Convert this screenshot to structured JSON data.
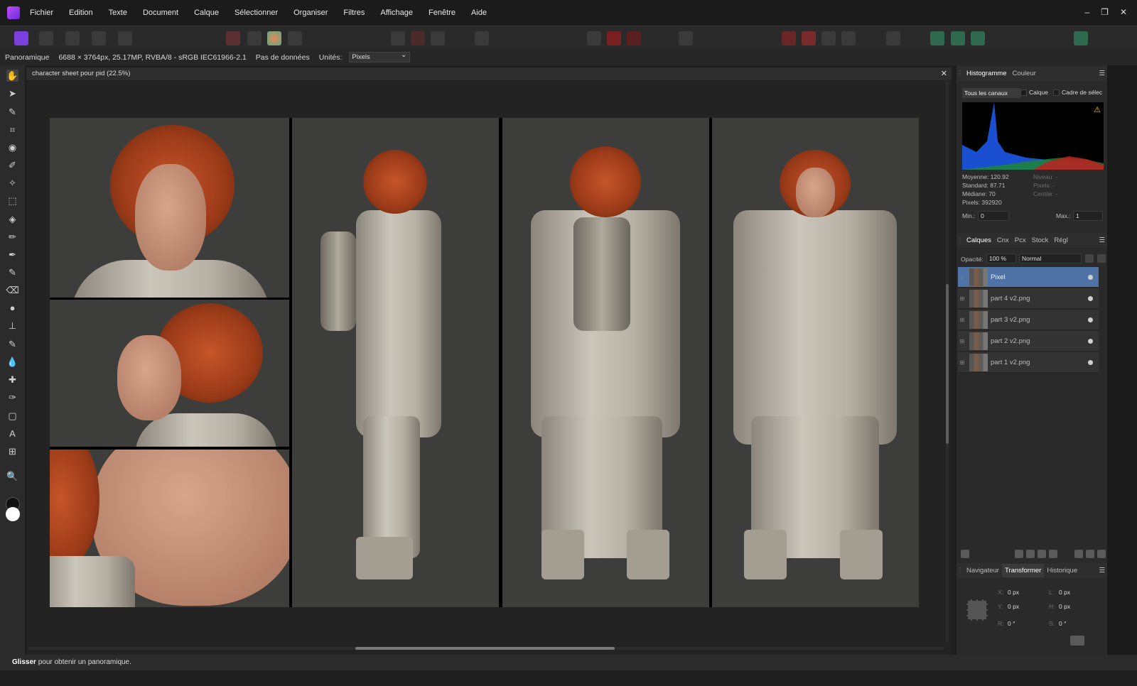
{
  "app": {
    "logo": "affinity-photo-logo",
    "menu": [
      "Fichier",
      "Edition",
      "Texte",
      "Document",
      "Calque",
      "Sélectionner",
      "Organiser",
      "Filtres",
      "Affichage",
      "Fenêtre",
      "Aide"
    ],
    "window_controls": {
      "minimize": "–",
      "restore": "❐",
      "close": "✕"
    }
  },
  "context": {
    "tool_name": "Panoramique",
    "image_info": "6688 × 3764px, 25.17MP, RVBA/8 - sRGB IEC61966-2.1",
    "data_label": "Pas de données",
    "units_label": "Unités:",
    "units_value": "Pixels"
  },
  "document": {
    "tab_title": "character sheet pour pid (22.5%)",
    "close_label": "✕"
  },
  "status": {
    "bold": "Glisser",
    "text": " pour obtenir un panoramique."
  },
  "histogram_panel": {
    "tabs": [
      "Histogramme",
      "Couleur"
    ],
    "channel_select": "Tous les canaux",
    "checkbox_layer": "Calque",
    "checkbox_selection": "Cadre de sélec",
    "warning_icon": "warning-icon",
    "stats_left": [
      "Moyenne: 120.92",
      "Standard: 87.71",
      "Médiane: 70",
      "Pixels: 392920"
    ],
    "stats_right": [
      "Niveau: -",
      "Pixels: -",
      "Centile: -"
    ],
    "min_label": "Min.:",
    "min_value": "0",
    "max_label": "Max.:",
    "max_value": "1"
  },
  "layers_panel": {
    "tabs": [
      "Calques",
      "Cnx",
      "Pcx",
      "Stock",
      "Régl"
    ],
    "opacity_label": "Opacité:",
    "opacity_value": "100 %",
    "blend_mode": "Normal",
    "layers": [
      {
        "name": "Pixel",
        "selected": true
      },
      {
        "name": "part 4 v2.png"
      },
      {
        "name": "part 3 v2.png"
      },
      {
        "name": "part 2 v2.png"
      },
      {
        "name": "part 1 v2.png"
      }
    ]
  },
  "transform_panel": {
    "tabs": [
      "Navigateur",
      "Transformer",
      "Historique"
    ],
    "x_label": "X:",
    "x_value": "0 px",
    "y_label": "Y:",
    "y_value": "0 px",
    "w_label": "L:",
    "w_value": "0 px",
    "h_label": "H:",
    "h_value": "0 px",
    "r_label": "R:",
    "r_value": "0 °",
    "s_label": "S:",
    "s_value": "0 °"
  }
}
